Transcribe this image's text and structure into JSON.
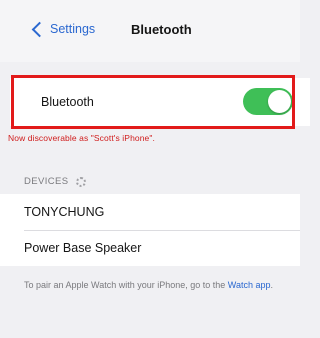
{
  "nav": {
    "back_label": "Settings",
    "title": "Bluetooth"
  },
  "bluetooth": {
    "label": "Bluetooth",
    "enabled": true,
    "toggle_color": "#3fbf57"
  },
  "discoverable_text": "Now discoverable as \"Scott's iPhone\".",
  "devices_section": {
    "header": "DEVICES"
  },
  "devices": [
    {
      "name": "TONYCHUNG"
    },
    {
      "name": "Power Base Speaker"
    }
  ],
  "footer": {
    "text_before": "To pair an Apple Watch with your iPhone, go to the ",
    "link": "Watch app",
    "text_after": "."
  },
  "colors": {
    "accent": "#2b68d0",
    "highlight": "#e21a1a"
  }
}
